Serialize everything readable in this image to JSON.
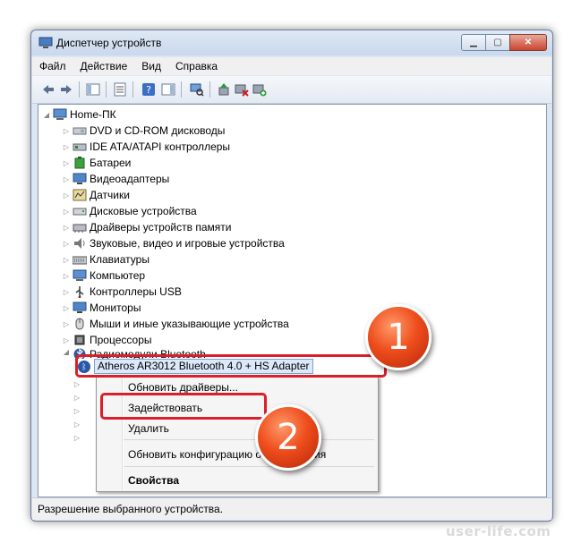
{
  "window": {
    "title": "Диспетчер устройств"
  },
  "menu": [
    "Файл",
    "Действие",
    "Вид",
    "Справка"
  ],
  "tree": {
    "root": "Home-ПК",
    "categories": [
      "DVD и CD-ROM дисководы",
      "IDE ATA/ATAPI контроллеры",
      "Батареи",
      "Видеоадаптеры",
      "Датчики",
      "Дисковые устройства",
      "Драйверы устройств памяти",
      "Звуковые, видео и игровые устройства",
      "Клавиатуры",
      "Компьютер",
      "Контроллеры USB",
      "Мониторы",
      "Мыши и иные указывающие устройства",
      "Процессоры",
      "Радиомодули Bluetooth"
    ],
    "selected_device": "Atheros AR3012 Bluetooth 4.0 + HS Adapter"
  },
  "context_menu": {
    "update_drivers": "Обновить драйверы...",
    "enable": "Задействовать",
    "delete": "Удалить",
    "scan": "Обновить конфигурацию оборудования",
    "properties": "Свойства"
  },
  "status": "Разрешение выбранного устройства.",
  "callouts": [
    "1",
    "2"
  ],
  "watermark": "user-life.com",
  "colors": {
    "highlight": "#d9202a",
    "badge": "#ef4d1c",
    "selection": "#dce9f9"
  }
}
